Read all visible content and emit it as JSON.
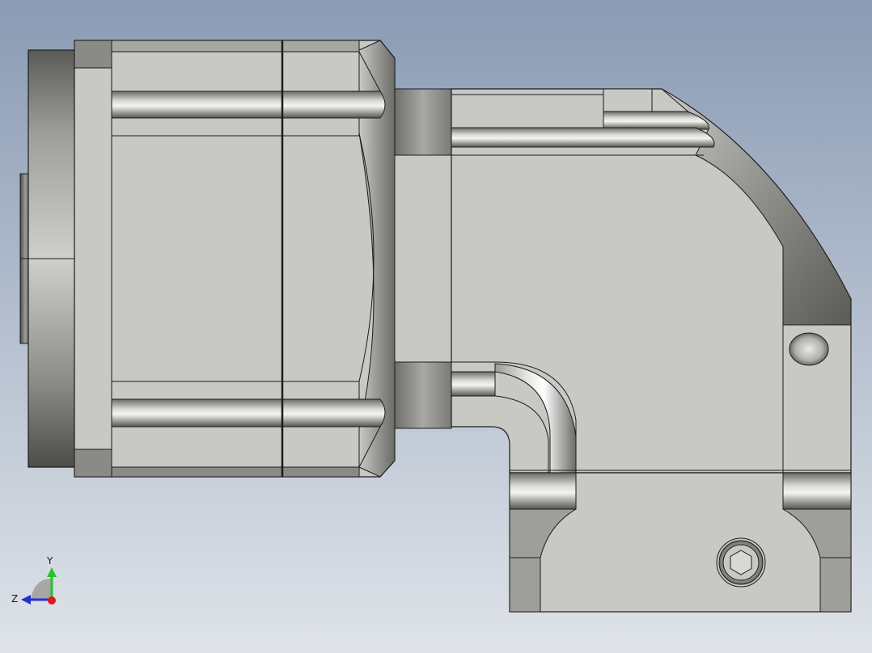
{
  "viewport": {
    "background_top": "#8a9bb4",
    "background_bottom": "#dfe3e9"
  },
  "model": {
    "body_color": "#c8c8c4",
    "edge_color": "#1c1c1c",
    "shade_dark": "#5d5d59",
    "shade_light": "#f2f2ee"
  },
  "triad": {
    "y_label": "Y",
    "z_label": "Z",
    "y_color": "#22c42a",
    "z_color": "#2233cc",
    "x_color": "#dd1a1a"
  }
}
